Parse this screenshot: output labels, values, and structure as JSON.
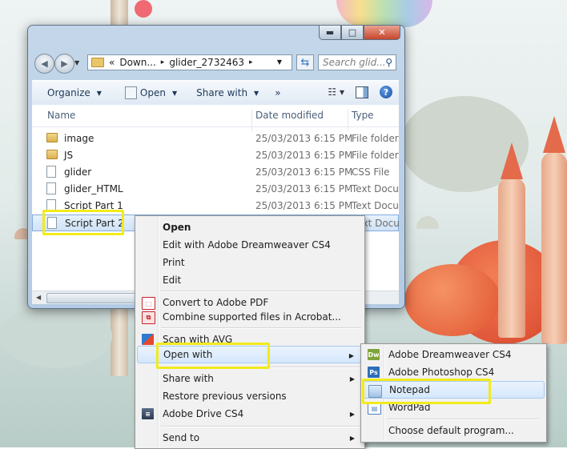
{
  "window": {
    "controls": {
      "minimize": "▬",
      "maximize": "□",
      "close": "✕"
    },
    "address": {
      "prefix": "«",
      "crumbs": [
        "Down...",
        "glider_2732463"
      ],
      "separator": "▸"
    },
    "search_placeholder": "Search glid..."
  },
  "toolbar": {
    "organize": "Organize",
    "open": "Open",
    "share_with": "Share with",
    "more": "»"
  },
  "columns": {
    "name": "Name",
    "date": "Date modified",
    "type": "Type"
  },
  "files": [
    {
      "name": "image",
      "date": "25/03/2013 6:15 PM",
      "type": "File folder",
      "icon": "folder-icon"
    },
    {
      "name": "JS",
      "date": "25/03/2013 6:15 PM",
      "type": "File folder",
      "icon": "folder-icon"
    },
    {
      "name": "glider",
      "date": "25/03/2013 6:15 PM",
      "type": "CSS File",
      "icon": "file-icon"
    },
    {
      "name": "glider_HTML",
      "date": "25/03/2013 6:15 PM",
      "type": "Text Document",
      "icon": "file-icon"
    },
    {
      "name": "Script Part 1",
      "date": "25/03/2013 6:15 PM",
      "type": "Text Document",
      "icon": "file-icon"
    },
    {
      "name": "Script Part 2",
      "date": "",
      "type": "Text Document",
      "icon": "file-icon",
      "selected": true
    }
  ],
  "context_menu": [
    {
      "label": "Open",
      "bold": true
    },
    {
      "label": "Edit with Adobe Dreamweaver CS4"
    },
    {
      "label": "Print"
    },
    {
      "label": "Edit"
    },
    {
      "label": "Convert to Adobe PDF",
      "icon": "pdf-icon"
    },
    {
      "label": "Combine supported files in Acrobat...",
      "icon": "acrobat-icon"
    },
    {
      "label": "Scan with AVG",
      "icon": "avg-icon"
    },
    {
      "label": "Open with",
      "submenu": true,
      "hot": true
    },
    {
      "label": "Share with",
      "submenu": true
    },
    {
      "label": "Restore previous versions"
    },
    {
      "label": "Adobe Drive CS4",
      "submenu": true,
      "icon": "adobe-drive-icon"
    },
    {
      "label": "Send to",
      "submenu": true
    }
  ],
  "open_with_menu": [
    {
      "label": "Adobe Dreamweaver CS4",
      "icon_text": "Dw",
      "icon_color": "#7fa33a"
    },
    {
      "label": "Adobe Photoshop CS4",
      "icon_text": "Ps",
      "icon_color": "#2c6fb7"
    },
    {
      "label": "Notepad",
      "icon_text": "",
      "icon_color": "#9fc1e6",
      "hot": true
    },
    {
      "label": "WordPad",
      "icon_text": "",
      "icon_color": "#4f7fc0"
    },
    {
      "label": "Choose default program..."
    }
  ],
  "highlight_color": "#f2ea1c"
}
